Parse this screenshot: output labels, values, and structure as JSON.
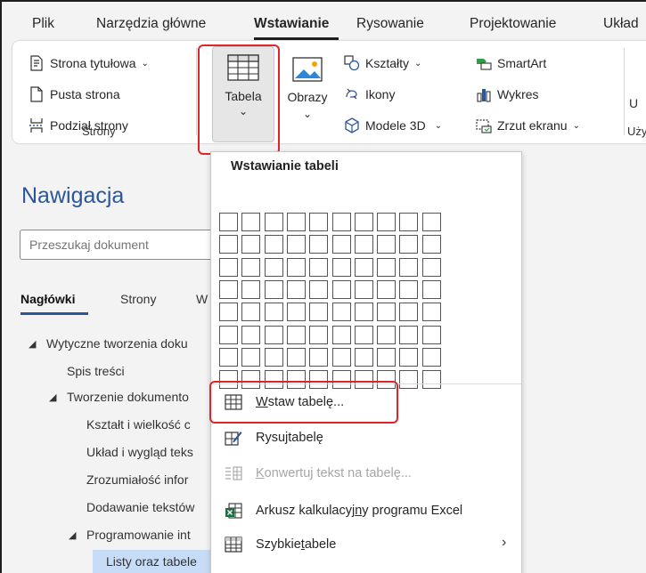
{
  "tabs": [
    "Plik",
    "Narzędzia główne",
    "Wstawianie",
    "Rysowanie",
    "Projektowanie",
    "Układ"
  ],
  "ribbon": {
    "strony": {
      "items": [
        "Strona tytułowa",
        "Pusta strona",
        "Podział strony"
      ],
      "group_label": "Strony"
    },
    "tabela_label": "Tabela",
    "obrazy_label": "Obrazy",
    "ilustracje": {
      "ksztalty": "Kształty",
      "ikony": "Ikony",
      "modele": "Modele 3D",
      "smartart": "SmartArt",
      "wykres": "Wykres",
      "zrzut": "Zrzut ekranu"
    },
    "right_partial": "U",
    "right_group_partial": "Uży"
  },
  "navigation": {
    "title": "Nawigacja",
    "search_placeholder": "Przeszukaj dokument",
    "tabs": [
      "Nagłówki",
      "Strony",
      "W"
    ],
    "tree": [
      "Wytyczne tworzenia doku",
      "Spis treści",
      "Tworzenie dokumento",
      "Kształt i wielkość c",
      "Układ i wygląd teks",
      "Zrozumiałość infor",
      "Dodawanie tekstów",
      "Programowanie int",
      "Listy oraz tabele"
    ]
  },
  "dropdown": {
    "title": "Wstawianie tabeli",
    "grid": {
      "cols": 10,
      "rows": 8
    },
    "items": {
      "wstaw": {
        "pre": "",
        "u": "W",
        "post": "staw tabelę..."
      },
      "rysuj": {
        "pre": "Rysu",
        "u": "j",
        "post": " tabelę"
      },
      "konwertuj": {
        "pre": "",
        "u": "K",
        "post": "onwertuj tekst na tabelę..."
      },
      "arkusz": {
        "pre": "Arkusz kalkulacyj",
        "u": "n",
        "post": "y programu Excel"
      },
      "szybkie": {
        "pre": "Szybkie ",
        "u": "t",
        "post": "abele"
      }
    }
  },
  "colors": {
    "accent_blue": "#2b579a",
    "highlight_red": "#e0242c",
    "excel_green": "#1d6f42",
    "selection_blue": "#c7ddf7"
  }
}
